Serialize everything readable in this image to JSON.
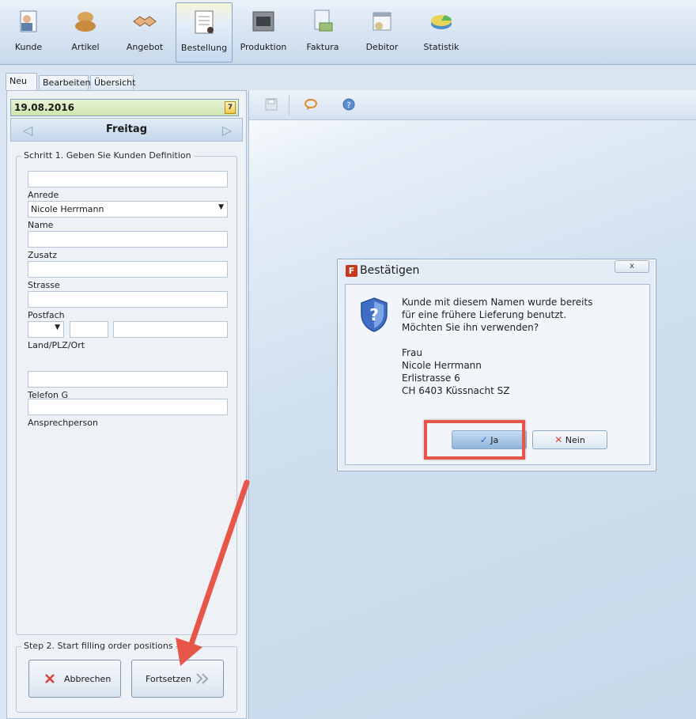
{
  "ribbon": {
    "items": [
      {
        "label": "Kunde",
        "icon": "customer-icon"
      },
      {
        "label": "Artikel",
        "icon": "bread-icon"
      },
      {
        "label": "Angebot",
        "icon": "handshake-icon"
      },
      {
        "label": "Bestellung",
        "icon": "order-document-icon",
        "active": true
      },
      {
        "label": "Produktion",
        "icon": "oven-icon"
      },
      {
        "label": "Faktura",
        "icon": "invoice-icon"
      },
      {
        "label": "Debitor",
        "icon": "debtor-calendar-icon"
      },
      {
        "label": "Statistik",
        "icon": "pie-chart-icon"
      }
    ]
  },
  "tabs": [
    "Neu",
    "Bearbeiten",
    "Übersicht"
  ],
  "date": {
    "value": "19.08.2016",
    "calendar_glyph": "7",
    "day": "Freitag"
  },
  "step1": {
    "legend": "Schritt 1. Geben Sie Kunden Definition",
    "anrede_label": "Anrede",
    "name_value": "Nicole Herrmann",
    "name_label": "Name",
    "zusatz_label": "Zusatz",
    "strasse_label": "Strasse",
    "postfach_label": "Postfach",
    "land_label": "Land/PLZ/Ort",
    "telefon_label": "Telefon G",
    "ansprech_label": "Ansprechperson"
  },
  "step2": {
    "legend": "Step 2. Start filling order positions",
    "cancel_label": "Abbrechen",
    "continue_label": "Fortsetzen"
  },
  "dialog": {
    "title": "Bestätigen",
    "app_letter": "F",
    "close_glyph": "x",
    "lines": [
      "Kunde mit diesem Namen wurde bereits",
      "für eine frühere Lieferung benutzt.",
      "Möchten Sie ihn verwenden?"
    ],
    "address": [
      "Frau",
      "Nicole Herrmann",
      "Erlistrasse 6",
      "CH 6403 Küssnacht SZ"
    ],
    "yes_label": "Ja",
    "no_label": "Nein"
  },
  "colors": {
    "annotation": "#e8564a",
    "date_bar": "#cfe5ad"
  }
}
